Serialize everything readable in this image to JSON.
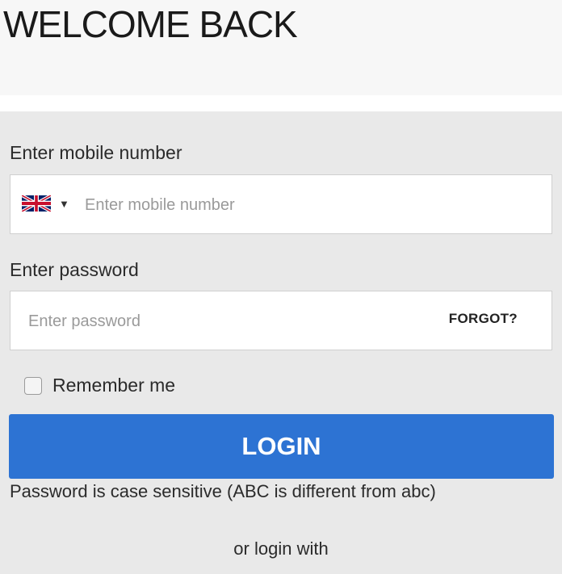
{
  "header": {
    "title": "WELCOME BACK"
  },
  "mobile": {
    "label": "Enter mobile number",
    "placeholder": "Enter mobile number",
    "value": "",
    "country_flag": "uk-flag-icon"
  },
  "password": {
    "label": "Enter password",
    "placeholder": "Enter password",
    "value": "",
    "forgot_label": "FORGOT?"
  },
  "remember": {
    "label": "Remember me",
    "checked": false
  },
  "login": {
    "button_label": "LOGIN",
    "accent_color": "#2d73d3"
  },
  "hint": {
    "text": "Password is case sensitive (ABC is different from abc)"
  },
  "alternate": {
    "text": "or login with"
  }
}
